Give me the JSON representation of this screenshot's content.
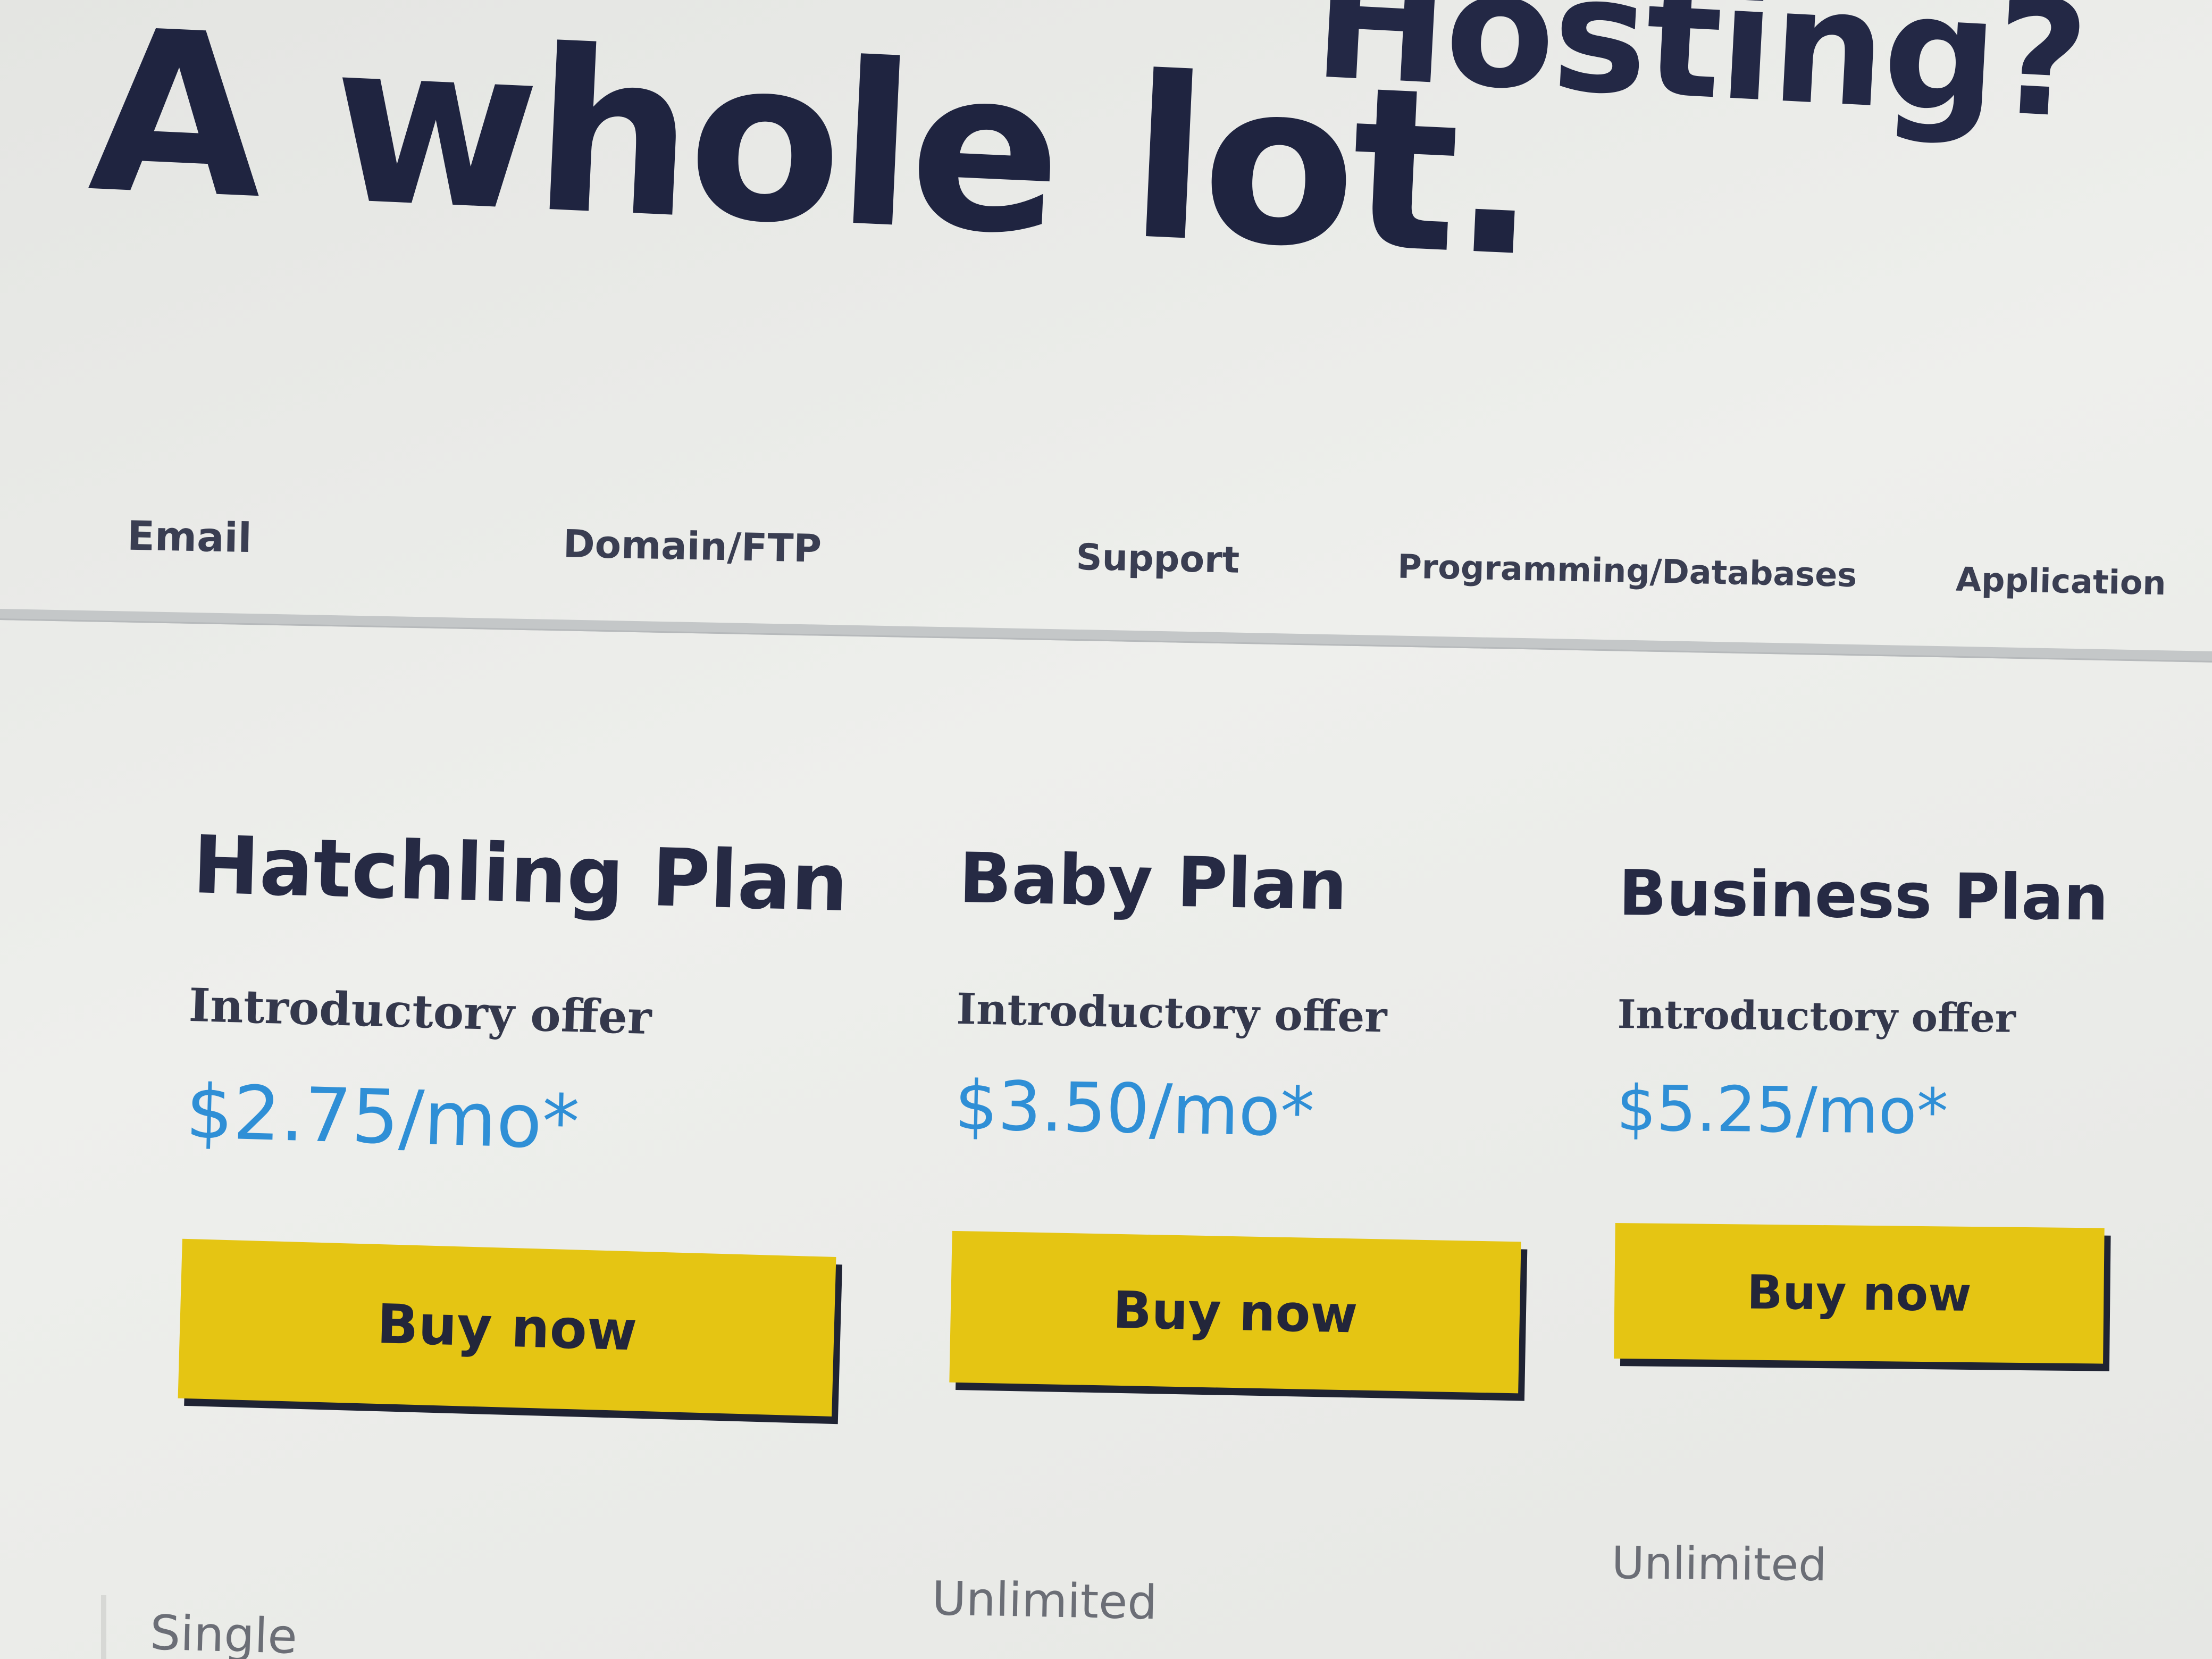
{
  "hero": {
    "headline_top": "Hosting?",
    "headline": "A whole lot."
  },
  "tabs": [
    {
      "label": "Email"
    },
    {
      "label": "Domain/FTP"
    },
    {
      "label": "Support"
    },
    {
      "label": "Programming/Databases"
    },
    {
      "label": "Application"
    }
  ],
  "plans": [
    {
      "title": "Hatchling Plan",
      "offer": "Introductory offer",
      "price": "$2.75/mo*",
      "button_label": "Buy now",
      "feature": "Single"
    },
    {
      "title": "Baby Plan",
      "offer": "Introductory offer",
      "price": "$3.50/mo*",
      "button_label": "Buy now",
      "feature": "Unlimited"
    },
    {
      "title": "Business Plan",
      "offer": "Introductory offer",
      "price": "$5.25/mo*",
      "button_label": "Buy now",
      "feature": "Unlimited"
    }
  ],
  "colors": {
    "heading": "#1f2440",
    "price": "#2f8fd6",
    "button": "#e5c513",
    "button_shadow": "#1f2333",
    "background": "#e9eae7"
  }
}
